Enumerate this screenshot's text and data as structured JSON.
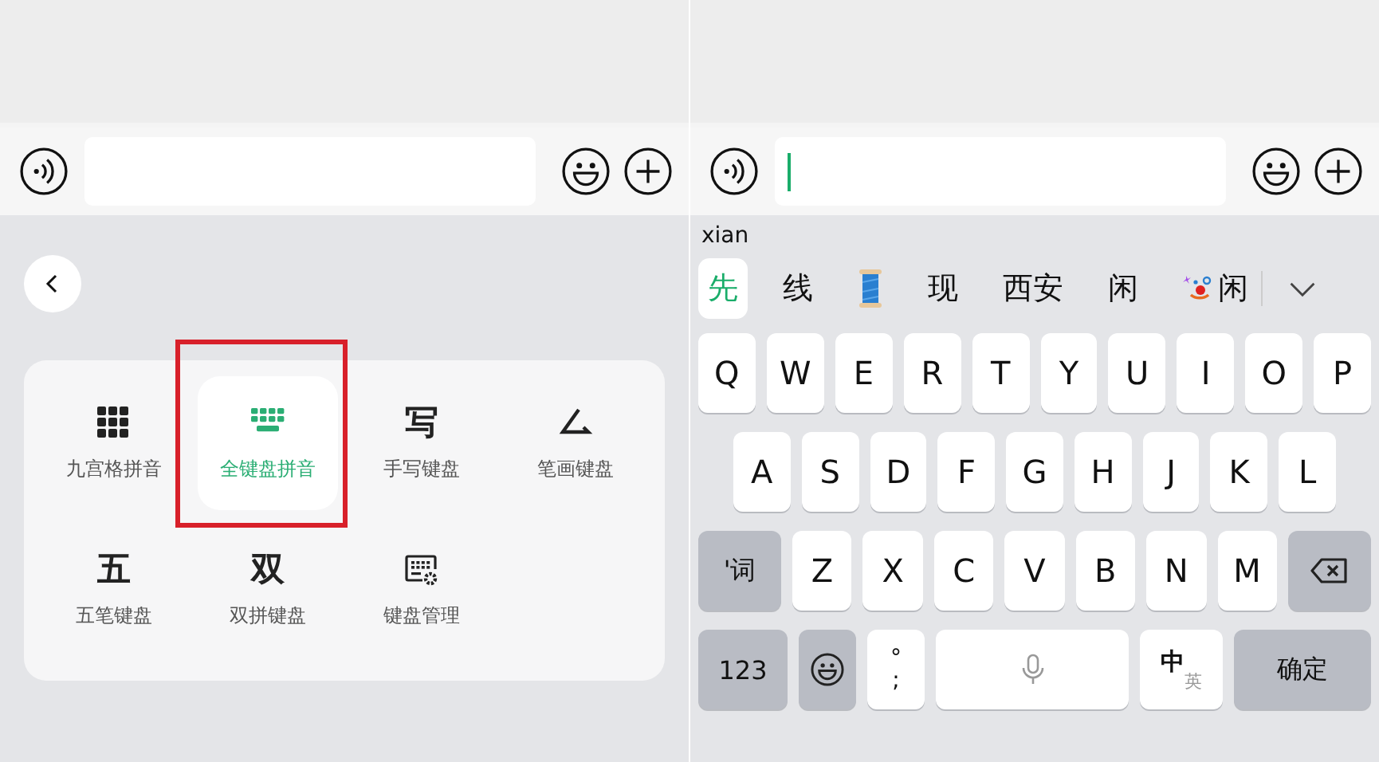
{
  "left_panel": {
    "keyboard_menu": {
      "items": [
        {
          "kind": "grid",
          "label": "九宫格拼音",
          "selected": false,
          "annotated": false
        },
        {
          "kind": "keyboard",
          "label": "全键盘拼音",
          "selected": true,
          "annotated": true
        },
        {
          "kind": "glyph",
          "glyph": "写",
          "label": "手写键盘",
          "selected": false,
          "annotated": false
        },
        {
          "kind": "stroke",
          "label": "笔画键盘",
          "selected": false,
          "annotated": false
        },
        {
          "kind": "glyph",
          "glyph": "五",
          "label": "五笔键盘",
          "selected": false,
          "annotated": false
        },
        {
          "kind": "glyph",
          "glyph": "双",
          "label": "双拼键盘",
          "selected": false,
          "annotated": false
        },
        {
          "kind": "manage",
          "label": "键盘管理",
          "selected": false,
          "annotated": false
        }
      ]
    }
  },
  "right_panel": {
    "pinyin": "xian",
    "candidates": [
      {
        "kind": "text",
        "text": "先",
        "selected": true
      },
      {
        "kind": "text",
        "text": "线",
        "selected": false
      },
      {
        "kind": "spool",
        "selected": false
      },
      {
        "kind": "text",
        "text": "现",
        "selected": false
      },
      {
        "kind": "text",
        "text": "西安",
        "selected": false
      },
      {
        "kind": "text",
        "text": "闲",
        "selected": false
      },
      {
        "kind": "clown",
        "text": "闲",
        "selected": false
      }
    ],
    "key_rows": [
      [
        {
          "kind": "letter",
          "label": "Q"
        },
        {
          "kind": "letter",
          "label": "W"
        },
        {
          "kind": "letter",
          "label": "E"
        },
        {
          "kind": "letter",
          "label": "R"
        },
        {
          "kind": "letter",
          "label": "T"
        },
        {
          "kind": "letter",
          "label": "Y"
        },
        {
          "kind": "letter",
          "label": "U"
        },
        {
          "kind": "letter",
          "label": "I"
        },
        {
          "kind": "letter",
          "label": "O"
        },
        {
          "kind": "letter",
          "label": "P"
        }
      ],
      [
        {
          "kind": "letter",
          "label": "A"
        },
        {
          "kind": "letter",
          "label": "S"
        },
        {
          "kind": "letter",
          "label": "D"
        },
        {
          "kind": "letter",
          "label": "F"
        },
        {
          "kind": "letter",
          "label": "G"
        },
        {
          "kind": "letter",
          "label": "H"
        },
        {
          "kind": "letter",
          "label": "J"
        },
        {
          "kind": "letter",
          "label": "K"
        },
        {
          "kind": "letter",
          "label": "L"
        }
      ],
      [
        {
          "kind": "function",
          "label": "'词"
        },
        {
          "kind": "letter",
          "label": "Z"
        },
        {
          "kind": "letter",
          "label": "X"
        },
        {
          "kind": "letter",
          "label": "C"
        },
        {
          "kind": "letter",
          "label": "V"
        },
        {
          "kind": "letter",
          "label": "B"
        },
        {
          "kind": "letter",
          "label": "N"
        },
        {
          "kind": "letter",
          "label": "M"
        },
        {
          "kind": "backspace"
        }
      ],
      [
        {
          "kind": "numbers",
          "label": "123"
        },
        {
          "kind": "emoji"
        },
        {
          "kind": "punct",
          "top": "°",
          "bottom": ";"
        },
        {
          "kind": "space"
        },
        {
          "kind": "lang",
          "main": "中",
          "sub": "英"
        },
        {
          "kind": "enter",
          "label": "确定"
        }
      ]
    ]
  }
}
